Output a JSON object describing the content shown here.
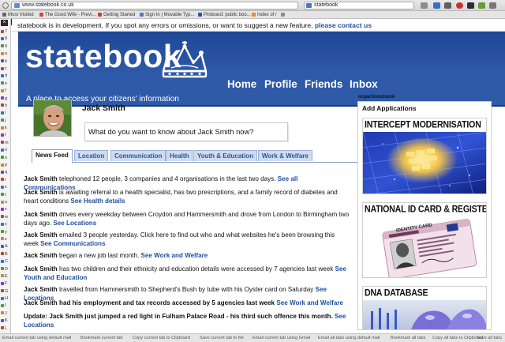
{
  "browser": {
    "url": "www.statebook.co.uk",
    "search_text": "statebook",
    "bookmarks": [
      "Most Visited",
      "The Good Wife - Previ...",
      "Getting Started",
      "Sign In | Movable Typ...",
      "Pinboard: public boo...",
      "Index of /",
      ""
    ],
    "statusbar": [
      "Email current tab using default mail",
      "Bookmark current tab",
      "Copy current tab to Clipboard",
      "Save current tab to file",
      "Email current tab using Gmail",
      "Email all tabs using default mail",
      "Bookmark all tabs",
      "Copy all tabs to Clipboard",
      "Save all tabs"
    ],
    "sidebar_close": "×",
    "sidebar_items": [
      "7",
      "8",
      "9",
      "a",
      "b",
      "c",
      "d",
      "e",
      "f",
      "g",
      "h",
      "i",
      "j",
      "k",
      "l",
      "m",
      "n",
      "o",
      "p",
      "q",
      "r",
      "s",
      "t",
      "u",
      "v",
      "w",
      "x",
      "y",
      "z",
      "A",
      "B",
      "C",
      "D",
      "E",
      "F",
      "G",
      "H",
      "I",
      "J",
      "K",
      "L"
    ]
  },
  "notice": {
    "text": "statebook is in development. If you spot any errors or omissions, or want to suggest a new feature, ",
    "link": "please contact us"
  },
  "header": {
    "logo": "statebook",
    "tagline": "A place to access your citizens' information",
    "nav": [
      "Home",
      "Profile",
      "Friends",
      "Inbox"
    ]
  },
  "profile": {
    "name": "Jack Smith",
    "question": "What do you want to know about Jack Smith now?"
  },
  "tabs": [
    "News Feed",
    "Location",
    "Communication",
    "Health",
    "Youth & Education",
    "Work & Welfare"
  ],
  "feed": [
    {
      "name": "Jack Smith",
      "text": " telephoned 12 people, 3 companies and 4 organisations in the last two days. ",
      "link": "See all Communications"
    },
    {
      "name": "Jack Smith",
      "text": " is awaiting referral to a health specialist, has two prescriptions, and a family record of diabetes and heart conditions ",
      "link": "See Health details"
    },
    {
      "name": "Jack Smith",
      "text": " drives every weekday between Croydon and Hammersmith and drove from London to Birmingham two days ago. ",
      "link": "See Locations"
    },
    {
      "name": "Jack Smith",
      "text": " emailed 3 people yesterday. Click here to find out who and what websites he's been browsing this week ",
      "link": "See Communications"
    },
    {
      "name": "Jack Smith",
      "text": " began a new job last month. ",
      "link": "See Work and Welfare"
    },
    {
      "name": "Jack Smith",
      "text": " has two children and their ethnicity and education details were accessed by 7 agencies last week ",
      "link": "See Youth and Education"
    },
    {
      "name": "Jack Smith",
      "text": " travelled from Hammersmith to Shepherd's Bush by tube with his Oyster card on Saturday ",
      "link": "See Locations"
    },
    {
      "name": "Jack Smith",
      "text": " had his employment and tax records accessed by 5 agencies last week ",
      "link": "See Work and Welfare",
      "bold": true
    },
    {
      "name": "Update:",
      "text": " Jack Smith just jumped a red light in Fulham Palace Road - his third such offence this month. ",
      "link": "See Locations",
      "bold": true
    }
  ],
  "sidebar_right": {
    "chunk_label": "orgactionchunk",
    "apps_title": "Add Applications",
    "apps": [
      {
        "title": "INTERCEPT MODERNISATION",
        "icon": "keyboard-image"
      },
      {
        "title": "NATIONAL ID CARD & REGISTER",
        "icon": "id-card-image"
      },
      {
        "title": "DNA DATABASE",
        "icon": "dna-lab-image"
      }
    ],
    "id_card_label": "IDENTITY CARD"
  }
}
